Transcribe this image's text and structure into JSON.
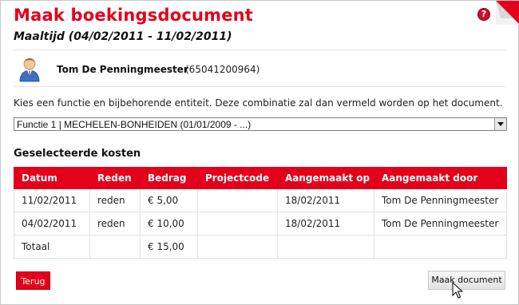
{
  "header": {
    "title": "Maak boekingsdocument",
    "subtitle": "Maaltijd (04/02/2011 - 11/02/2011)",
    "help_icon": "question-mark-icon",
    "help_glyph": "?",
    "corner_icon": "folded-corner-icon"
  },
  "user": {
    "avatar_icon": "user-avatar-icon",
    "name": "Tom De Penningmeester",
    "id": "(65041200964)"
  },
  "instruction": "Kies een functie en bijbehorende entiteit. Deze combinatie zal dan vermeld worden op het document.",
  "function_select": {
    "value": "Functie 1 | MECHELEN-BONHEIDEN (01/01/2009 - ...)"
  },
  "costs": {
    "title": "Geselecteerde kosten",
    "columns": [
      "Datum",
      "Reden",
      "Bedrag",
      "Projectcode",
      "Aangemaakt op",
      "Aangemaakt door"
    ],
    "rows": [
      [
        "11/02/2011",
        "reden",
        "€ 5,00",
        "",
        "18/02/2011",
        "Tom De Penningmeester"
      ],
      [
        "04/02/2011",
        "reden",
        "€ 10,00",
        "",
        "18/02/2011",
        "Tom De Penningmeester"
      ],
      [
        "Totaal",
        "",
        "€ 15,00",
        "",
        "",
        ""
      ]
    ]
  },
  "buttons": {
    "back_label": "Terug",
    "make_label": "Maak document"
  },
  "colors": {
    "brand_red": "#e3001b"
  }
}
